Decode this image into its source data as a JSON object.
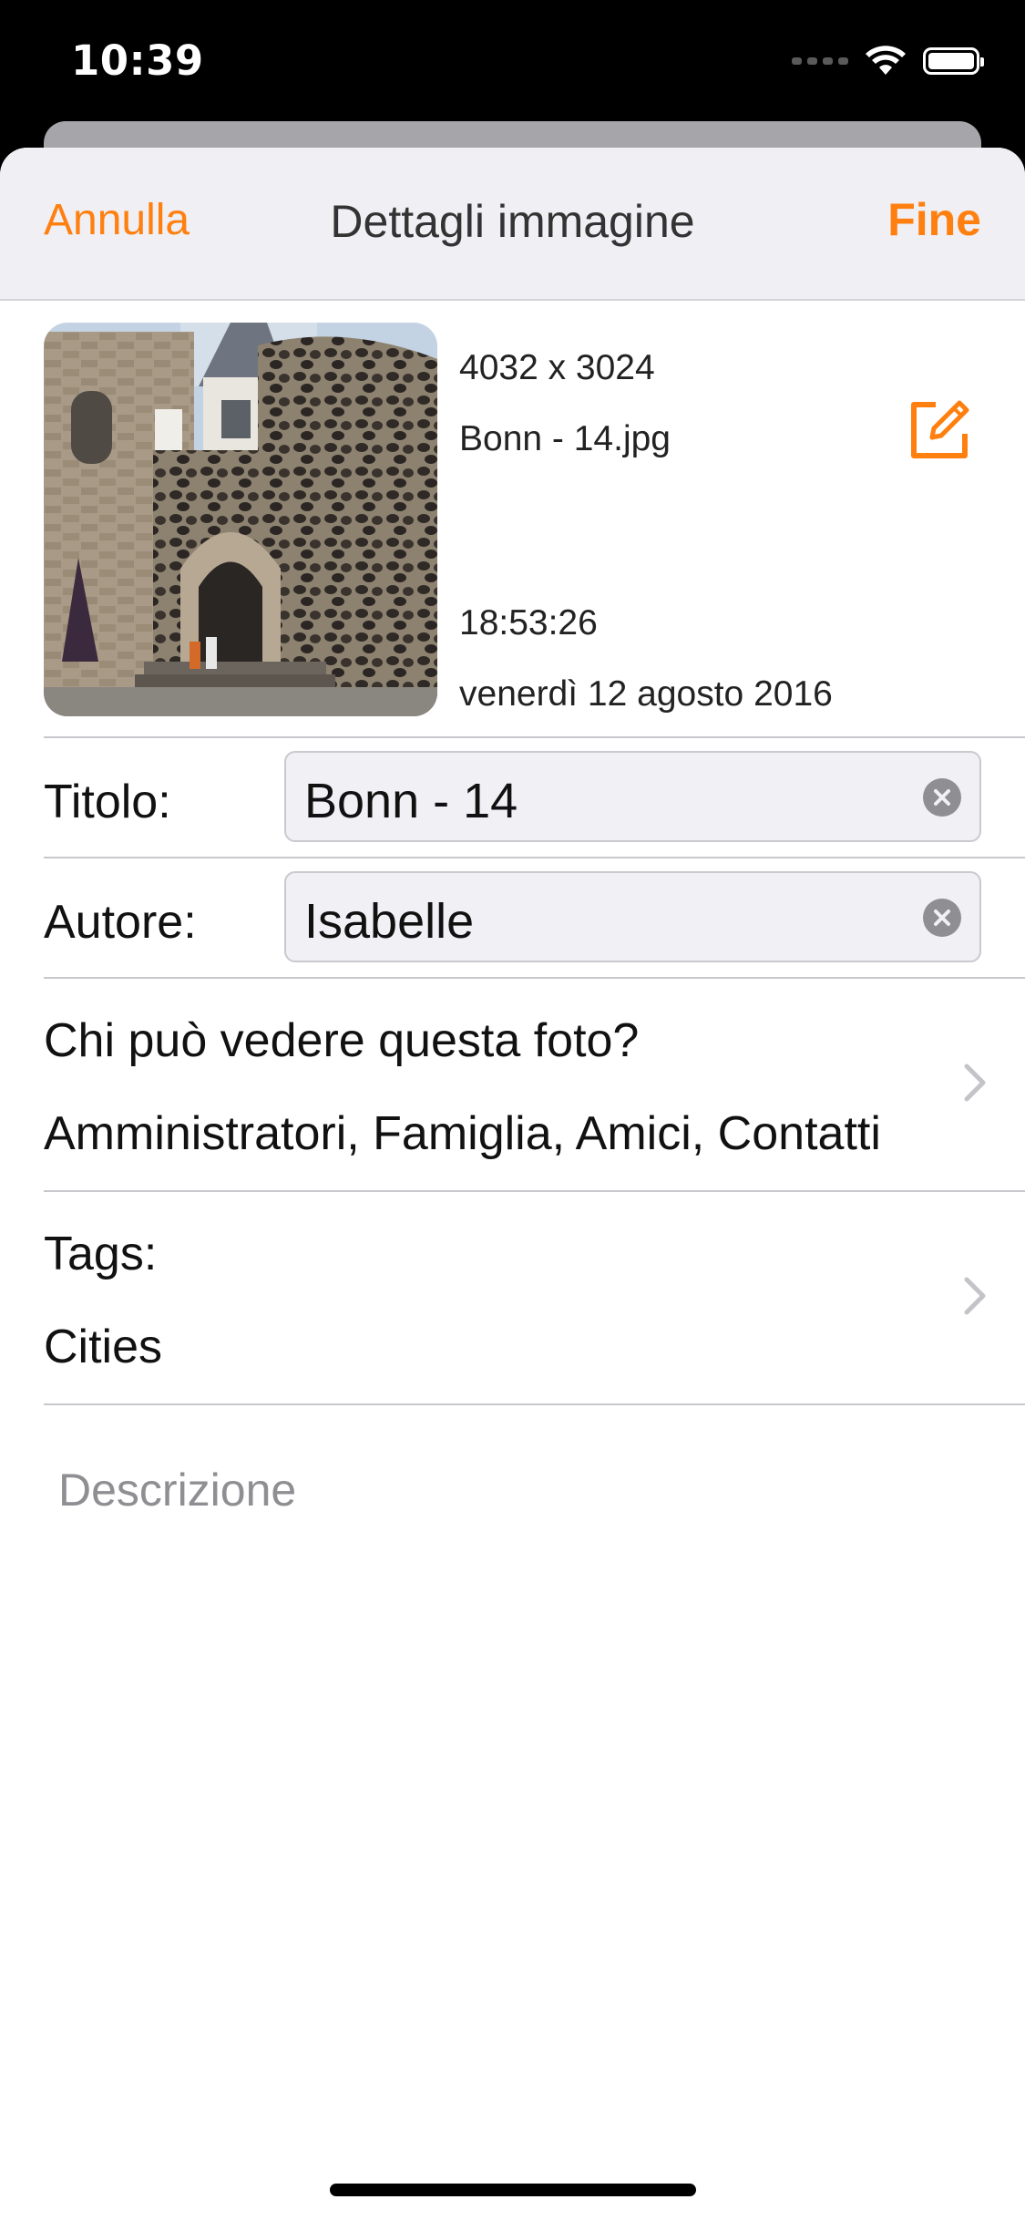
{
  "status_bar": {
    "time": "10:39"
  },
  "nav": {
    "cancel_label": "Annulla",
    "title": "Dettagli immagine",
    "done_label": "Fine",
    "accent_color": "#ff7f0f"
  },
  "image": {
    "dimensions": "4032 x 3024",
    "file_name": "Bonn - 14.jpg",
    "time": "18:53:26",
    "date": "venerdì 12 agosto 2016",
    "edit_icon": "edit-icon"
  },
  "fields": {
    "title": {
      "label": "Titolo:",
      "value": "Bonn - 14"
    },
    "author": {
      "label": "Autore:",
      "value": "Isabelle"
    }
  },
  "privacy": {
    "label": "Chi può vedere questa foto?",
    "value": "Amministratori, Famiglia, Amici, Contatti"
  },
  "tags": {
    "label": "Tags:",
    "value": "Cities"
  },
  "description": {
    "placeholder": "Descrizione"
  }
}
